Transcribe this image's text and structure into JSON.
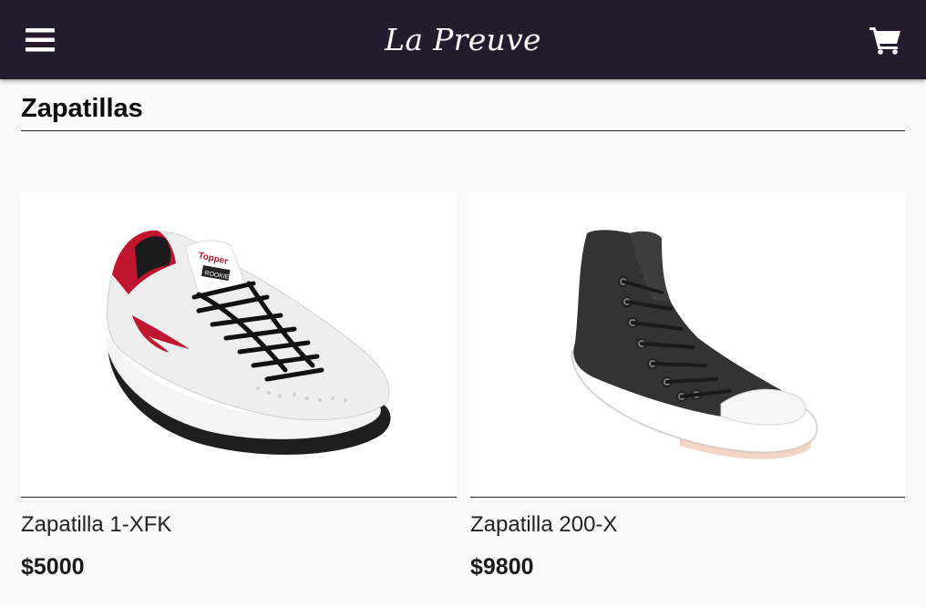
{
  "header": {
    "brand": "La Preuve",
    "menu_icon": "hamburger-menu-icon",
    "cart_icon": "shopping-cart-icon"
  },
  "section": {
    "title": "Zapatillas"
  },
  "products": [
    {
      "name": "Zapatilla 1-XFK",
      "price": "$5000",
      "image": "white-tennis-sneaker-image",
      "image_text": [
        "Topper",
        "ROOKIE"
      ]
    },
    {
      "name": "Zapatilla 200-X",
      "price": "$9800",
      "image": "black-high-top-sneaker-image"
    }
  ],
  "colors": {
    "header_bg": "#261a2e",
    "page_bg": "#f9f9f9",
    "accent_red": "#c0152f"
  }
}
